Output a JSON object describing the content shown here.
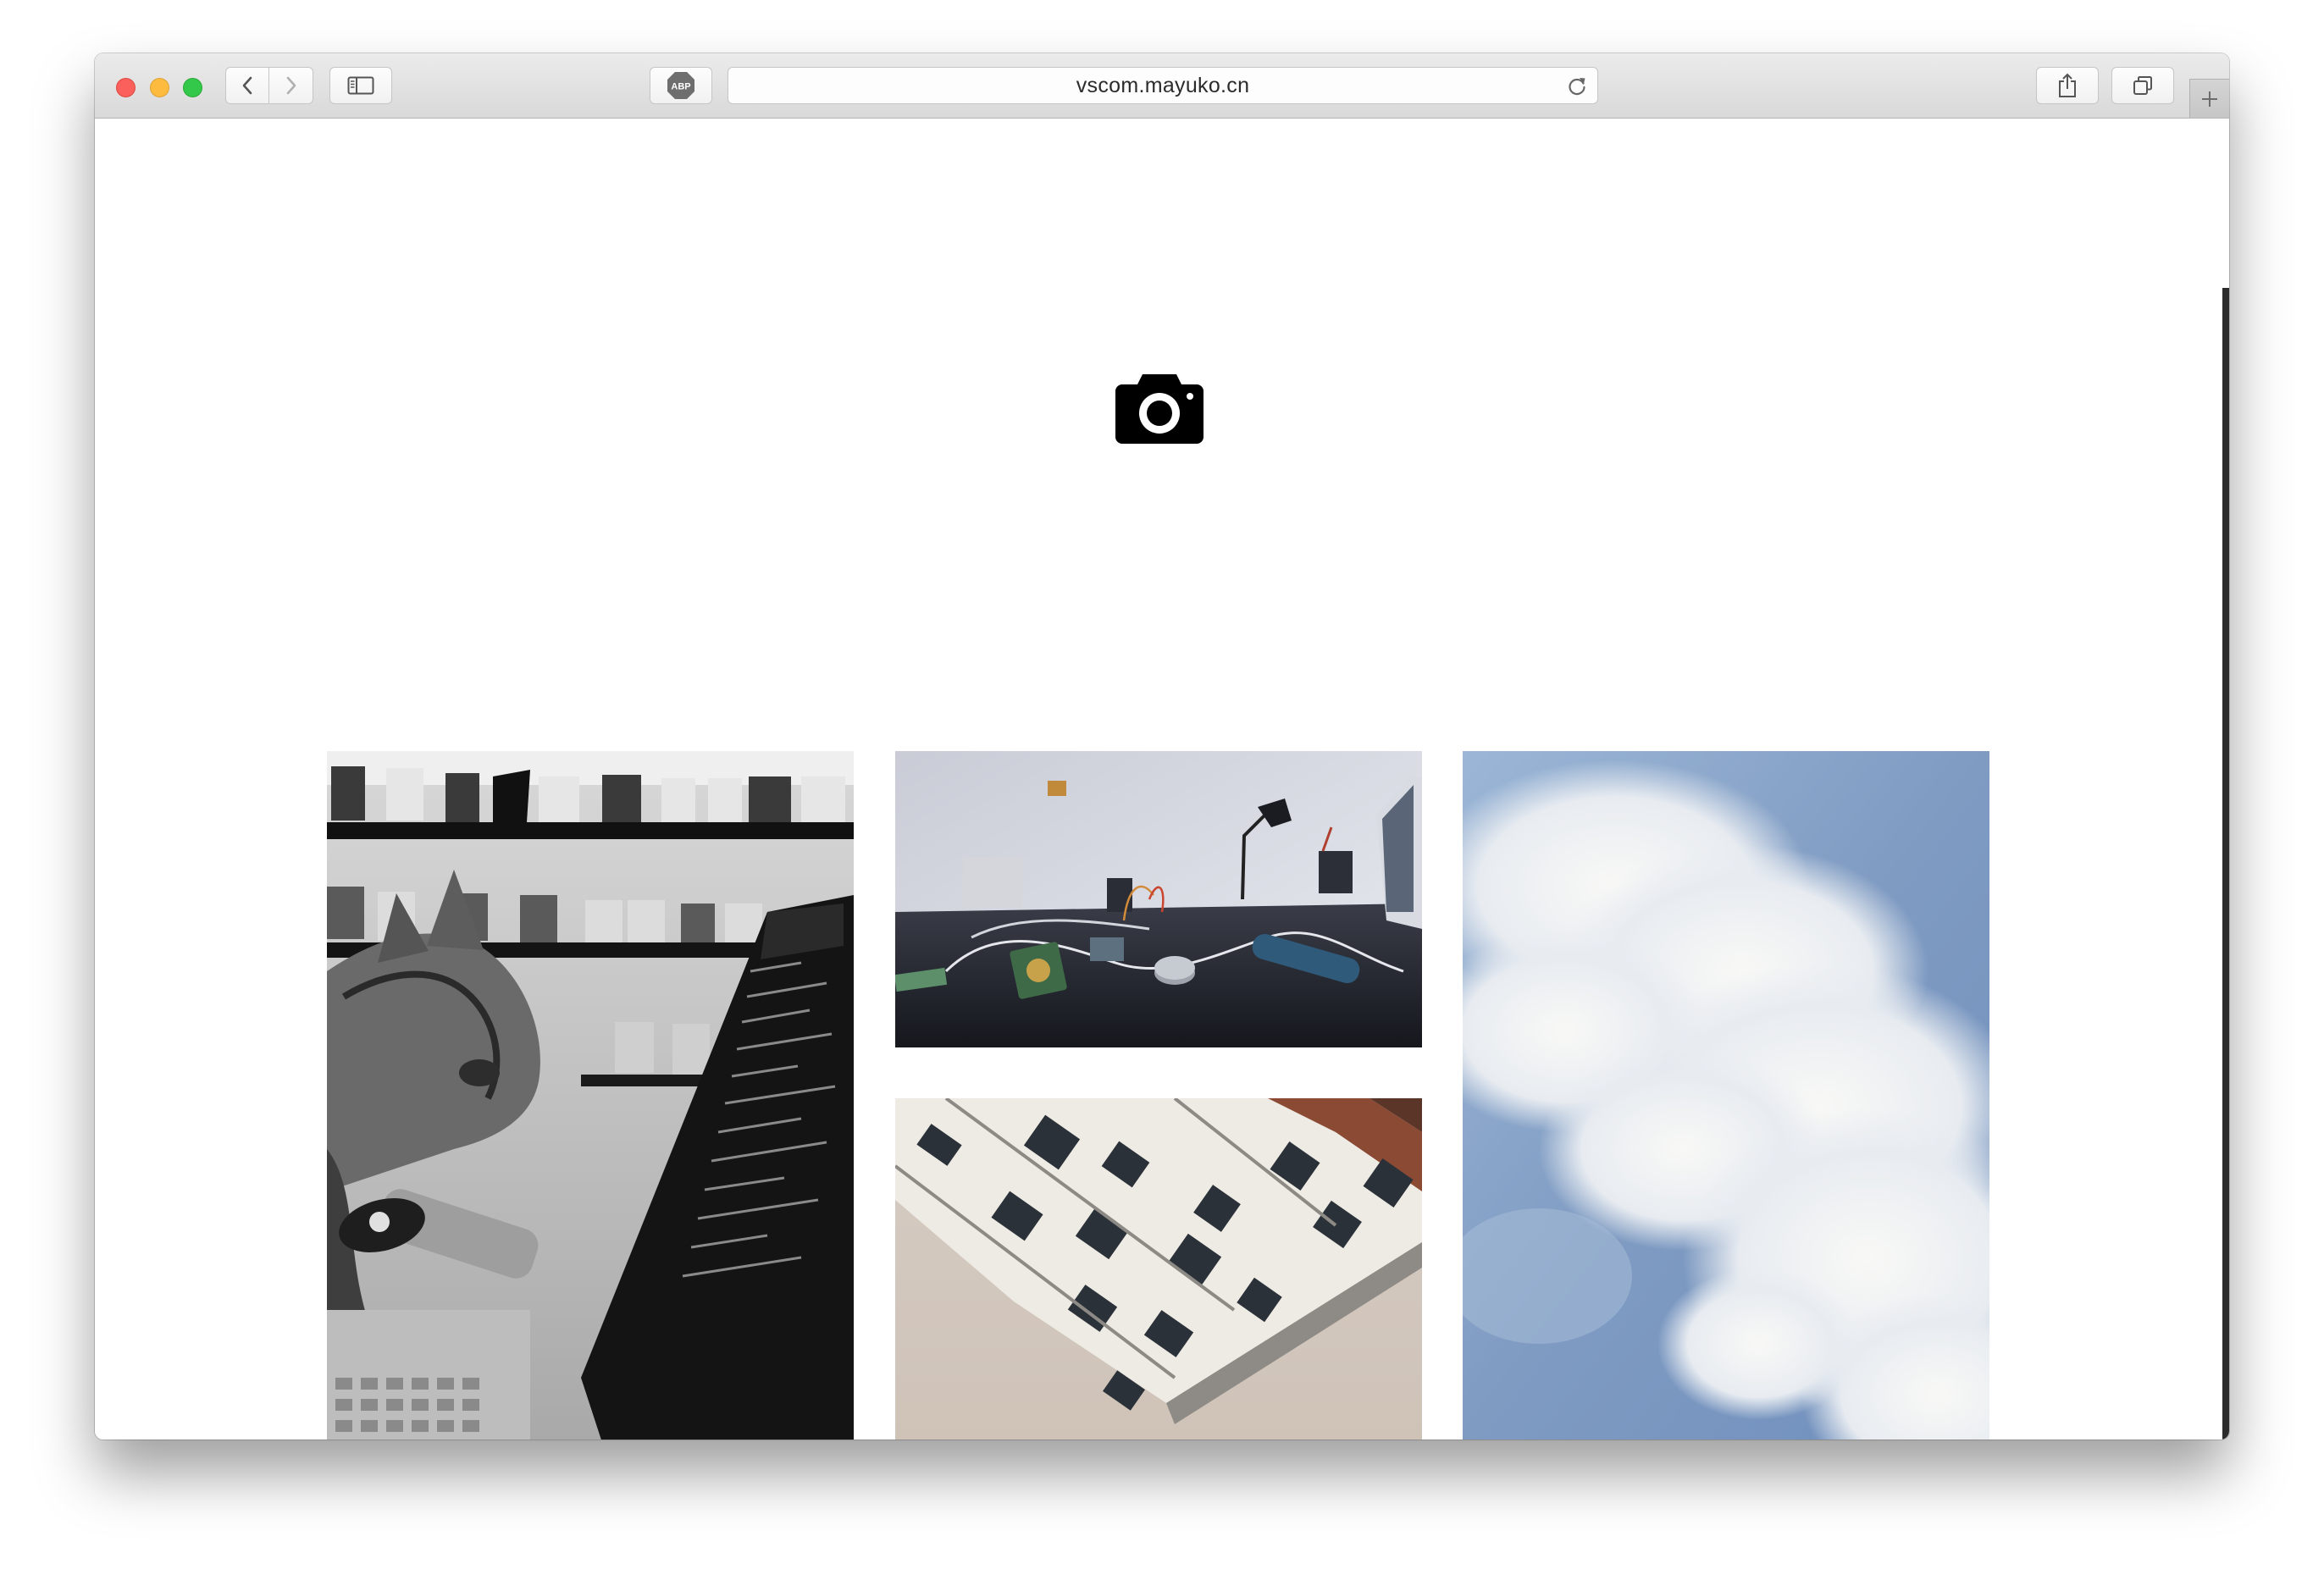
{
  "browser": {
    "url": "vscom.mayuko.cn",
    "toolbar_icons": [
      "back-chevron-icon",
      "forward-chevron-icon",
      "sidebar-icon",
      "adblock-icon",
      "reload-icon",
      "share-icon",
      "tabs-icon",
      "plus-icon"
    ],
    "adblock_label": "ABP"
  },
  "page": {
    "logo_icon": "camera-icon",
    "gallery": [
      {
        "subject": "cat-laptop-photo"
      },
      {
        "subject": "electronics-desk-photo"
      },
      {
        "subject": "building-facade-photo"
      },
      {
        "subject": "sky-clouds-photo"
      }
    ]
  }
}
